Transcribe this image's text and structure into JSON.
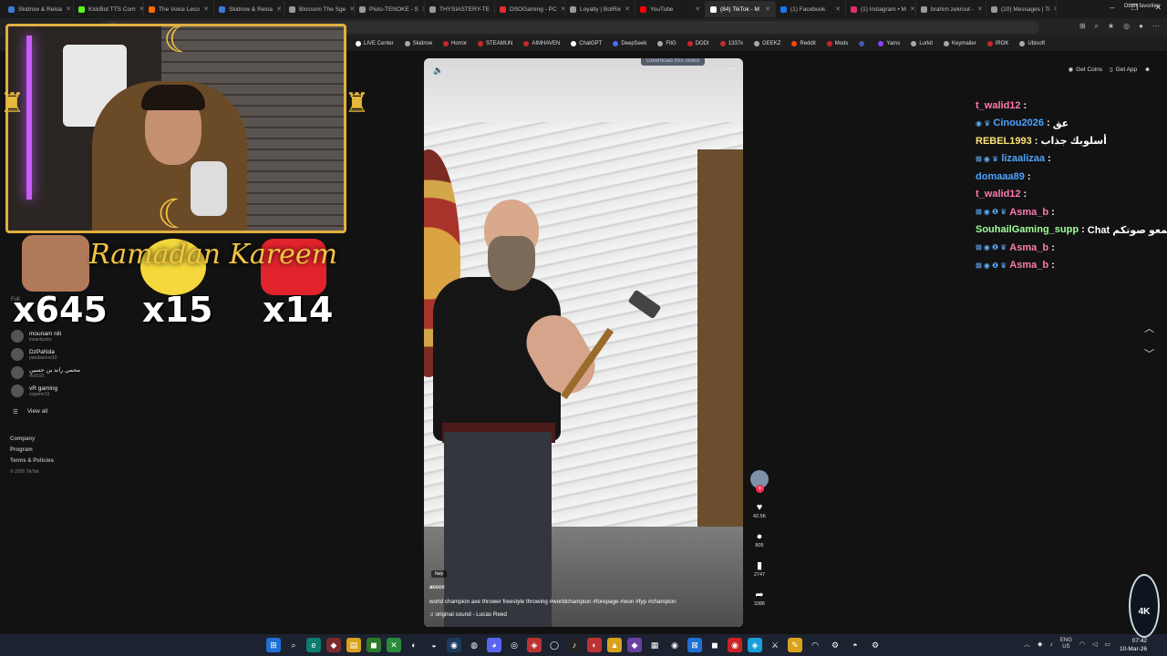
{
  "browser": {
    "tabs": [
      {
        "label": "Skidrow & Reloa",
        "color": "#3a7bd5"
      },
      {
        "label": "KickBot TTS Com",
        "color": "#53fc18"
      },
      {
        "label": "The Voice Leco",
        "color": "#ff6a00"
      },
      {
        "label": "Skidrow & Reloa",
        "color": "#3a7bd5"
      },
      {
        "label": "Blossom The Sge",
        "color": "#999999"
      },
      {
        "label": "Pluto-TENOKE - S",
        "color": "#999999"
      },
      {
        "label": "THYSIASTERY-TE",
        "color": "#999999"
      },
      {
        "label": "DSOGaming - PC",
        "color": "#e32d2d"
      },
      {
        "label": "Loyalty | BotRix",
        "color": "#999999"
      },
      {
        "label": "YouTube",
        "color": "#ff0000"
      },
      {
        "label": "(84) TikTok - M",
        "color": "#ffffff",
        "active": true
      },
      {
        "label": "(1) Facebook",
        "color": "#1877f2"
      },
      {
        "label": "(1) Instagram • M",
        "color": "#e1306c"
      },
      {
        "label": "brahim zekrout -",
        "color": "#999999"
      },
      {
        "label": "(10) Messages | Ti",
        "color": "#999999"
      }
    ],
    "url": "tiktok.com",
    "bookmarks": [
      {
        "label": "LIVE Center",
        "color": "#ffffff"
      },
      {
        "label": "Skidrow",
        "color": "#aaaaaa"
      },
      {
        "label": "Horror",
        "color": "#c62828"
      },
      {
        "label": "STEAMUN",
        "color": "#c62828"
      },
      {
        "label": "AIMHAVEN",
        "color": "#c62828"
      },
      {
        "label": "ChatGPT",
        "color": "#ffffff"
      },
      {
        "label": "DeepSeek",
        "color": "#4d6bfe"
      },
      {
        "label": "FitG",
        "color": "#aaaaaa"
      },
      {
        "label": "DODI",
        "color": "#c62828"
      },
      {
        "label": "1337x",
        "color": "#c62828"
      },
      {
        "label": "GEEKZ",
        "color": "#aaaaaa"
      },
      {
        "label": "Reddit",
        "color": "#ff4500"
      },
      {
        "label": "Mods",
        "color": "#c62828"
      },
      {
        "label": "",
        "color": "#4455aa"
      },
      {
        "label": "Yams",
        "color": "#8a3ffc"
      },
      {
        "label": "Lurkit",
        "color": "#aaaaaa"
      },
      {
        "label": "Keymailer",
        "color": "#aaaaaa"
      },
      {
        "label": "IROK",
        "color": "#c62828"
      },
      {
        "label": "Ubisoft",
        "color": "#aaaaaa"
      }
    ],
    "other_favorites": "Other favorites"
  },
  "tiktok": {
    "sidebar": {
      "following_label": "Foll",
      "accounts": [
        {
          "name": "mounam nili",
          "handle": "insanitydzz"
        },
        {
          "name": "DzPaNda",
          "handle": "pandazone33"
        },
        {
          "name": "محمي راند بن حسين",
          "handle": "rfcd191"
        },
        {
          "name": "vR gaming",
          "handle": "vrgame19"
        }
      ],
      "view_all": "View all",
      "footer": [
        "Company",
        "Program",
        "Terms & Policies"
      ],
      "copyright": "© 2026 TikTok"
    },
    "top_actions": {
      "coins": "Get Coins",
      "app": "Get App"
    },
    "video": {
      "download_hint": "Download this video",
      "location": "Italy",
      "author": "acccc",
      "description": "world champion axe thrower freestyle throwing #worldchampion #forepage #won #fyp #champion",
      "sound": "original sound - Lucas Reed"
    },
    "counts": {
      "likes": "42.5K",
      "comments": "805",
      "saves": "2747",
      "shares": "3386"
    }
  },
  "overlay": {
    "ramadan_text": "Ramadan Kareem",
    "counters": [
      "x645",
      "x15",
      "x14"
    ]
  },
  "chat": [
    {
      "user": "t_walid12",
      "user_color": "#ff7ab0",
      "msg": "",
      "badges": ""
    },
    {
      "user": "Cinou2026",
      "user_color": "#4da3ff",
      "msg": "عق",
      "badges": "◉ ♛"
    },
    {
      "user": "REBEL1993",
      "user_color": "#ffe27a",
      "msg": "أسلوبك جذاب",
      "badges": ""
    },
    {
      "user": "lizaalizaa",
      "user_color": "#4da3ff",
      "msg": "",
      "badges": "⊠ ◉ ♛"
    },
    {
      "user": "domaaa89",
      "user_color": "#4da3ff",
      "msg": "",
      "badges": ""
    },
    {
      "user": "t_walid12",
      "user_color": "#ff7ab0",
      "msg": "",
      "badges": ""
    },
    {
      "user": "Asma_b",
      "user_color": "#ff7ab0",
      "msg": "",
      "badges": "⊠ ◉ ❶ ♛"
    },
    {
      "user": "SouhailGaming_supp",
      "user_color": "#a0ff9a",
      "msg": "Chat نتمنا تسمعو صوتكم",
      "badges": ""
    },
    {
      "user": "Asma_b",
      "user_color": "#ff7ab0",
      "msg": "",
      "badges": "⊠ ◉ ❶ ♛"
    },
    {
      "user": "Asma_b",
      "user_color": "#ff7ab0",
      "msg": "",
      "badges": "⊠ ◉ ❶ ♛"
    }
  ],
  "taskbar": {
    "lang_top": "ENG",
    "lang_bottom": "US",
    "time": "07:42",
    "date": "10-Mar-26",
    "logo": "4K"
  }
}
